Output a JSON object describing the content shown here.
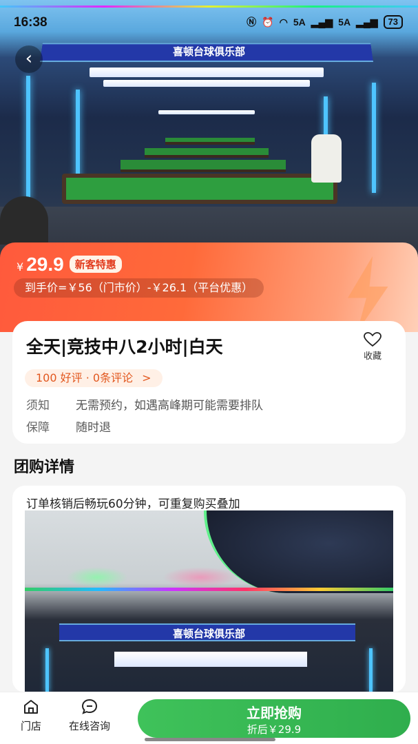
{
  "status_bar": {
    "time": "16:38",
    "network_1": "5A",
    "network_2": "5A",
    "battery": "73"
  },
  "hero": {
    "sign_text": "喜顿台球俱乐部",
    "back_icon": "chevron-left-icon"
  },
  "price": {
    "currency": "¥",
    "value": "29.9",
    "tag": "新客特惠",
    "breakdown": "到手价=￥56（门市价）-￥26.1（平台优惠）"
  },
  "deal": {
    "title": "全天|竞技中八2小时|白天",
    "favorite_label": "收藏",
    "favorite_icon": "heart-outline-icon",
    "rating_text": "100 好评 · 0条评论",
    "rating_chevron": ">",
    "notice_key": "须知",
    "notice_value": "无需预约，如遇高峰期可能需要排队",
    "guarantee_key": "保障",
    "guarantee_value": "随时退"
  },
  "details": {
    "section_title": "团购详情",
    "description": "订单核销后畅玩60分钟，可重复购买叠加",
    "image_sign_text": "喜顿台球俱乐部"
  },
  "bottom_bar": {
    "store_label": "门店",
    "store_icon": "store-icon",
    "consult_label": "在线咨询",
    "consult_icon": "chat-bubble-icon",
    "buy_label": "立即抢购",
    "buy_sub": "折后￥29.9"
  },
  "colors": {
    "accent_orange": "#ff5a3c",
    "buy_green": "#3fc25a",
    "rating_text": "#e2571e"
  }
}
